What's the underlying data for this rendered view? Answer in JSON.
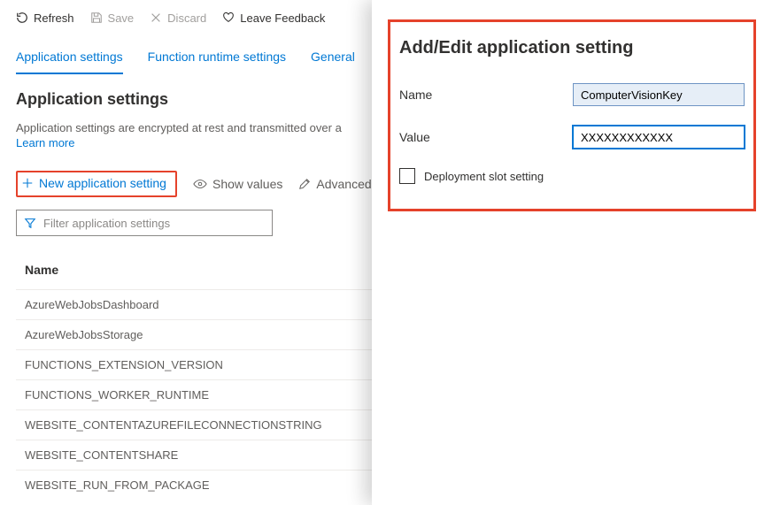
{
  "toolbar": {
    "refresh": "Refresh",
    "save": "Save",
    "discard": "Discard",
    "feedback": "Leave Feedback"
  },
  "tabs": {
    "app_settings": "Application settings",
    "runtime": "Function runtime settings",
    "general": "General"
  },
  "section": {
    "title": "Application settings",
    "desc": "Application settings are encrypted at rest and transmitted over a",
    "learn_more": "Learn more"
  },
  "actions": {
    "new_setting": "New application setting",
    "show_values": "Show values",
    "advanced": "Advanced"
  },
  "filter": {
    "placeholder": "Filter application settings"
  },
  "table": {
    "header_name": "Name",
    "rows": [
      "AzureWebJobsDashboard",
      "AzureWebJobsStorage",
      "FUNCTIONS_EXTENSION_VERSION",
      "FUNCTIONS_WORKER_RUNTIME",
      "WEBSITE_CONTENTAZUREFILECONNECTIONSTRING",
      "WEBSITE_CONTENTSHARE",
      "WEBSITE_RUN_FROM_PACKAGE"
    ]
  },
  "panel": {
    "title": "Add/Edit application setting",
    "name_label": "Name",
    "name_value": "ComputerVisionKey",
    "value_label": "Value",
    "value_value": "XXXXXXXXXXXX",
    "slot_label": "Deployment slot setting"
  }
}
